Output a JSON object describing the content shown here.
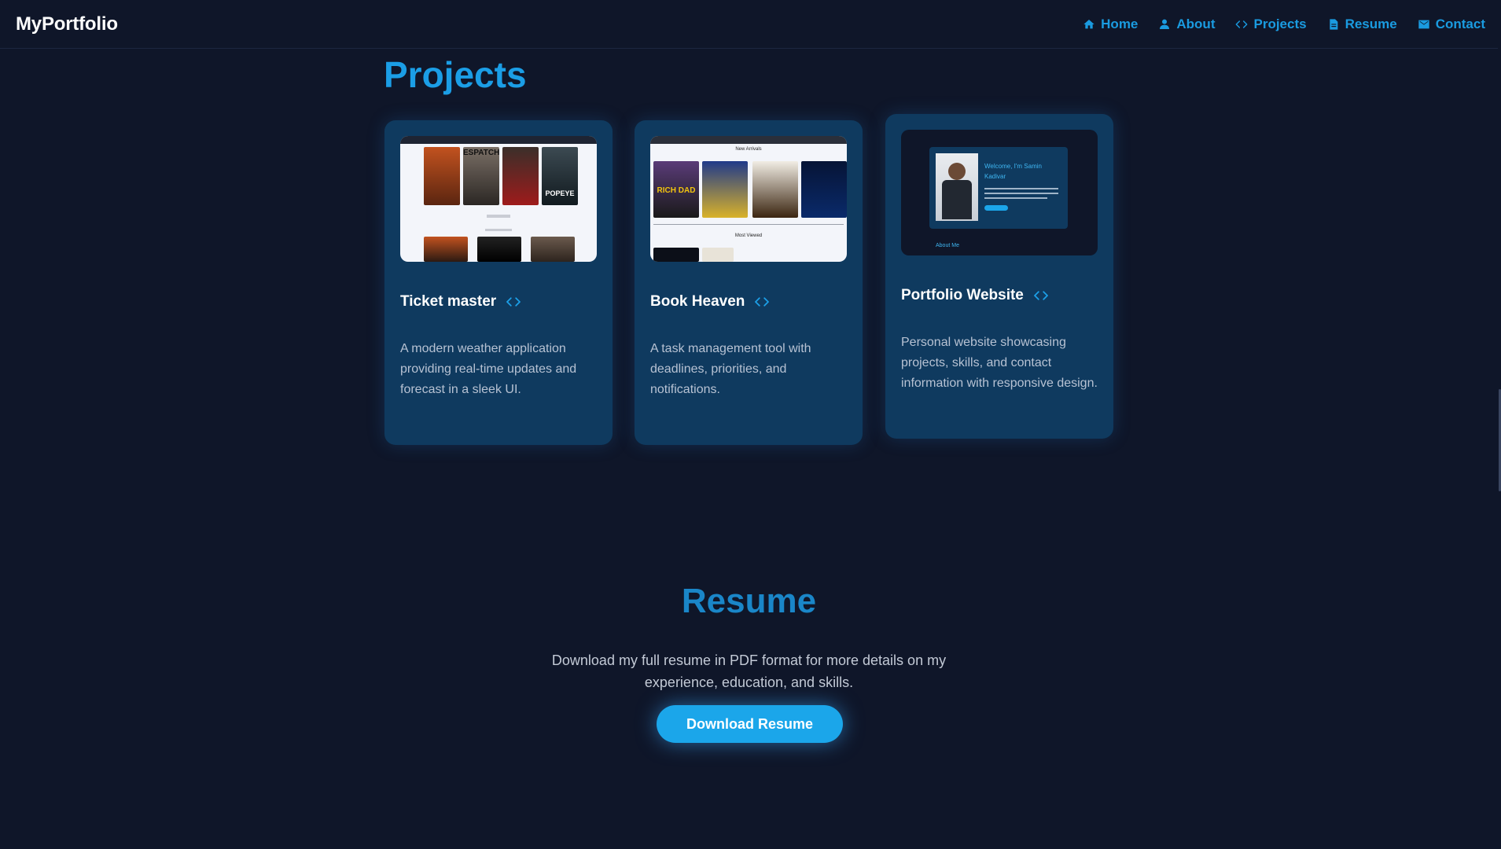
{
  "nav": {
    "brand": "MyPortfolio",
    "links": [
      {
        "label": "Home",
        "icon": "home-icon"
      },
      {
        "label": "About",
        "icon": "user-icon"
      },
      {
        "label": "Projects",
        "icon": "code-icon"
      },
      {
        "label": "Resume",
        "icon": "document-icon"
      },
      {
        "label": "Contact",
        "icon": "mail-icon"
      }
    ]
  },
  "projects": {
    "heading": "Projects",
    "cards": [
      {
        "title": "Ticket master",
        "description": "A modern weather application providing real-time updates and forecast in a sleek UI.",
        "thumbnail_texts": [
          "ESPATCH",
          "POPEYE"
        ]
      },
      {
        "title": "Book Heaven",
        "description": "A task management tool with deadlines, priorities, and notifications.",
        "thumbnail_texts": [
          "New Arrivals",
          "RICH DAD",
          "Most Viewed"
        ]
      },
      {
        "title": "Portfolio Website",
        "description": "Personal website showcasing projects, skills, and contact information with responsive design.",
        "thumbnail_texts": [
          "Welcome, I'm Samin Kadivar",
          "About Me"
        ]
      }
    ]
  },
  "resume": {
    "heading": "Resume",
    "text": "Download my full resume in PDF format for more details on my experience, education, and skills.",
    "button_label": "Download Resume"
  },
  "colors": {
    "background": "#0f1629",
    "accent": "#1b9ee6",
    "card": "#0f3a5f",
    "button": "#1ba6ea"
  }
}
